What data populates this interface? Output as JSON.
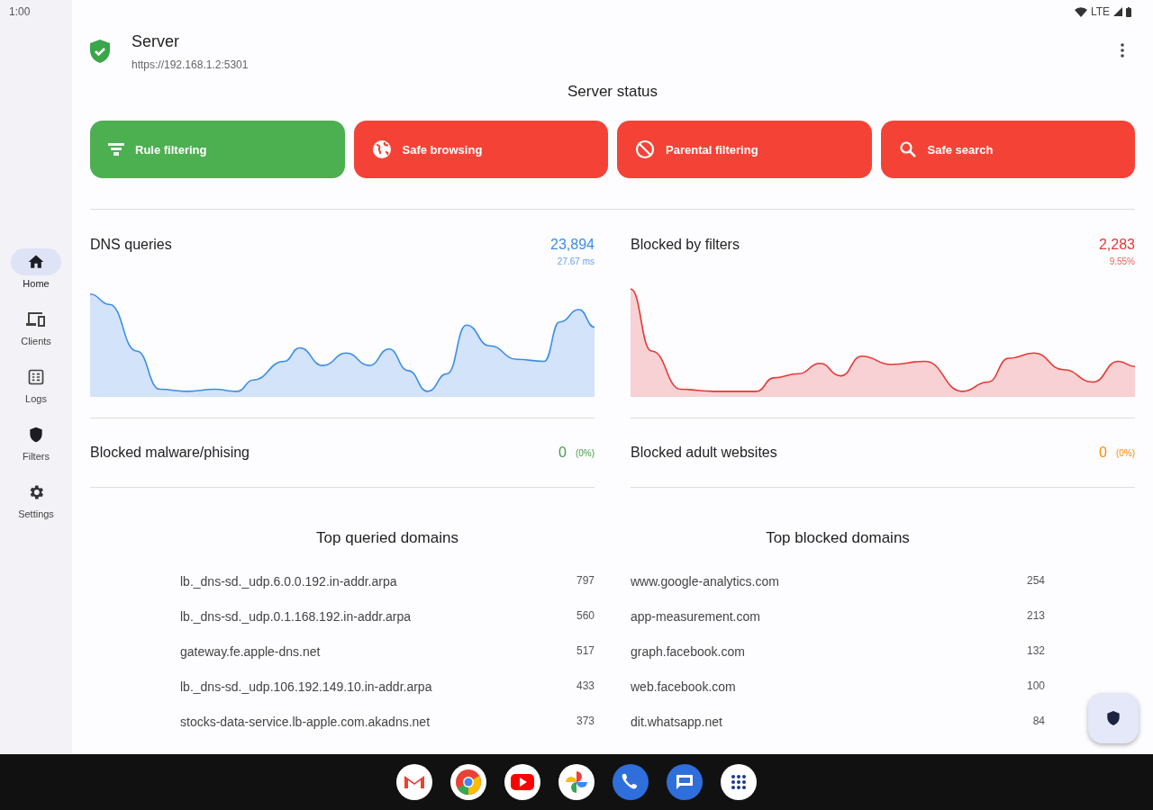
{
  "status_bar": {
    "time": "1:00",
    "network": "LTE"
  },
  "nav": [
    {
      "label": "Home",
      "selected": true
    },
    {
      "label": "Clients",
      "selected": false
    },
    {
      "label": "Logs",
      "selected": false
    },
    {
      "label": "Filters",
      "selected": false
    },
    {
      "label": "Settings",
      "selected": false
    }
  ],
  "server": {
    "name": "Server",
    "address": "https://192.168.1.2:5301"
  },
  "section_title": "Server status",
  "features": [
    {
      "label": "Rule filtering",
      "on": true
    },
    {
      "label": "Safe browsing",
      "on": false
    },
    {
      "label": "Parental filtering",
      "on": false
    },
    {
      "label": "Safe search",
      "on": false
    }
  ],
  "charts": [
    {
      "title": "DNS queries",
      "value": "23,894",
      "subvalue": "27.67 ms",
      "color": "#3d8ee6"
    },
    {
      "title": "Blocked by filters",
      "value": "2,283",
      "subvalue": "9.55%",
      "color": "#e53935"
    }
  ],
  "counters": [
    {
      "title": "Blocked malware/phising",
      "value": "0",
      "percent": "(0%)",
      "color": "#43a047"
    },
    {
      "title": "Blocked adult websites",
      "value": "0",
      "percent": "(0%)",
      "color": "#fb8c00"
    }
  ],
  "top_lists": [
    {
      "title": "Top queried domains",
      "rows": [
        {
          "domain": "lb._dns-sd._udp.6.0.0.192.in-addr.arpa",
          "count": "797"
        },
        {
          "domain": "lb._dns-sd._udp.0.1.168.192.in-addr.arpa",
          "count": "560"
        },
        {
          "domain": "gateway.fe.apple-dns.net",
          "count": "517"
        },
        {
          "domain": "lb._dns-sd._udp.106.192.149.10.in-addr.arpa",
          "count": "433"
        },
        {
          "domain": "stocks-data-service.lb-apple.com.akadns.net",
          "count": "373"
        }
      ]
    },
    {
      "title": "Top blocked domains",
      "rows": [
        {
          "domain": "www.google-analytics.com",
          "count": "254"
        },
        {
          "domain": "app-measurement.com",
          "count": "213"
        },
        {
          "domain": "graph.facebook.com",
          "count": "132"
        },
        {
          "domain": "web.facebook.com",
          "count": "100"
        },
        {
          "domain": "dit.whatsapp.net",
          "count": "84"
        }
      ]
    }
  ]
}
